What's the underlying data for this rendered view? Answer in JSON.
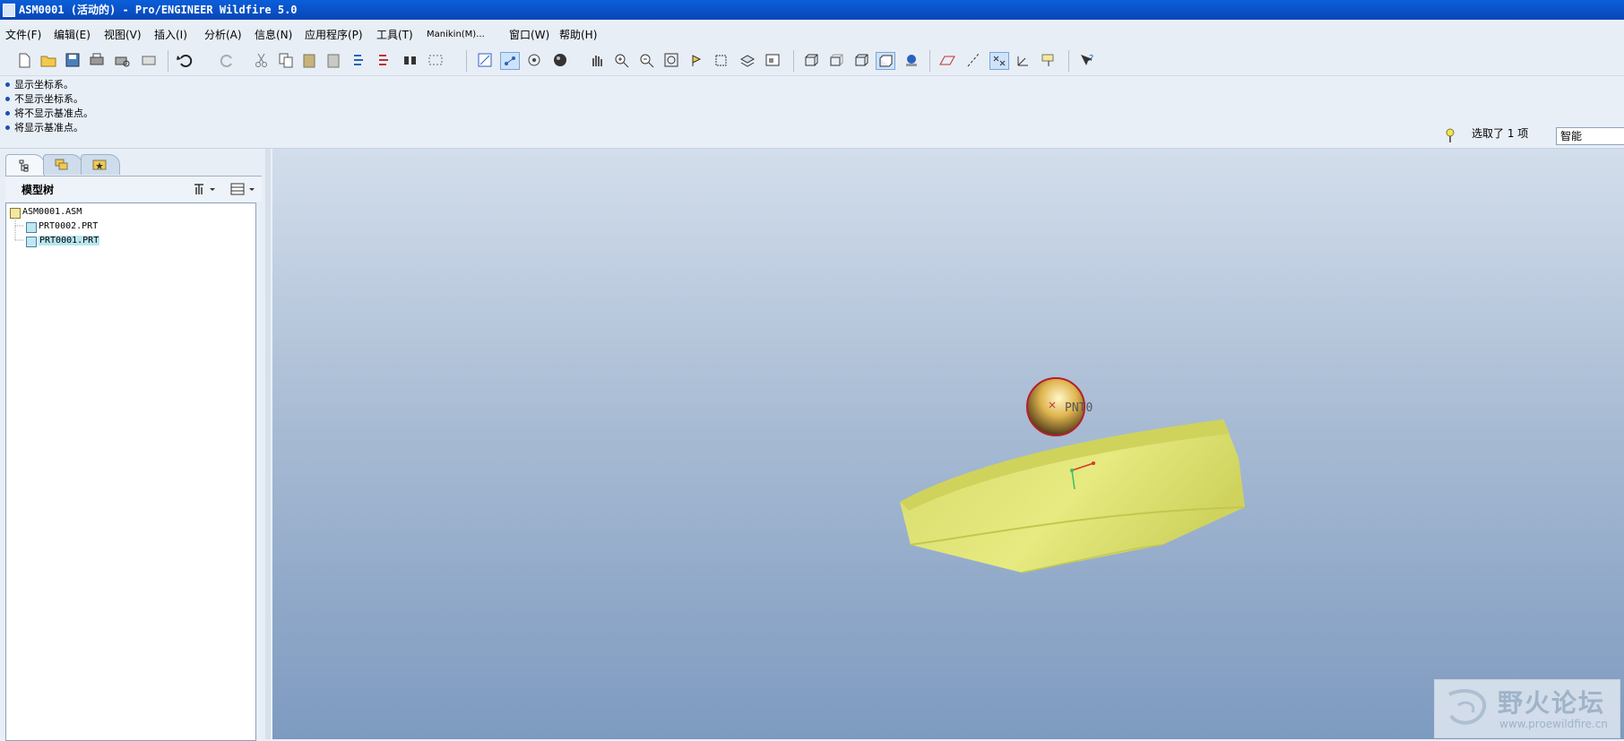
{
  "window": {
    "title": "ASM0001 (活动的) - Pro/ENGINEER Wildfire 5.0"
  },
  "menu": [
    "文件(F)",
    "编辑(E)",
    "视图(V)",
    "插入(I)",
    "分析(A)",
    "信息(N)",
    "应用程序(P)",
    "工具(T)",
    "Manikin(M)...",
    "窗口(W)",
    "帮助(H)"
  ],
  "messages": [
    "显示坐标系。",
    "不显示坐标系。",
    "将不显示基准点。",
    "将显示基准点。"
  ],
  "selection": {
    "count_text": "选取了 1 项",
    "filter_value": "智能"
  },
  "model_tree": {
    "title": "模型树",
    "nodes": [
      {
        "label": "ASM0001.ASM",
        "type": "assembly"
      },
      {
        "label": "PRT0002.PRT",
        "type": "part"
      },
      {
        "label": "PRT0001.PRT",
        "type": "part",
        "selected": true
      }
    ]
  },
  "viewport": {
    "point_label": "PNT0"
  },
  "watermark": {
    "name": "野火论坛",
    "url": "www.proewildfire.cn"
  },
  "colors": {
    "title_bar": "#0a5fd8",
    "viewport_top": "#d3deec",
    "viewport_bottom": "#7d9ac0",
    "part_fill": "#d9df6a",
    "sphere": "#c89a3a",
    "selection_highlight": "#b8e6f0"
  }
}
